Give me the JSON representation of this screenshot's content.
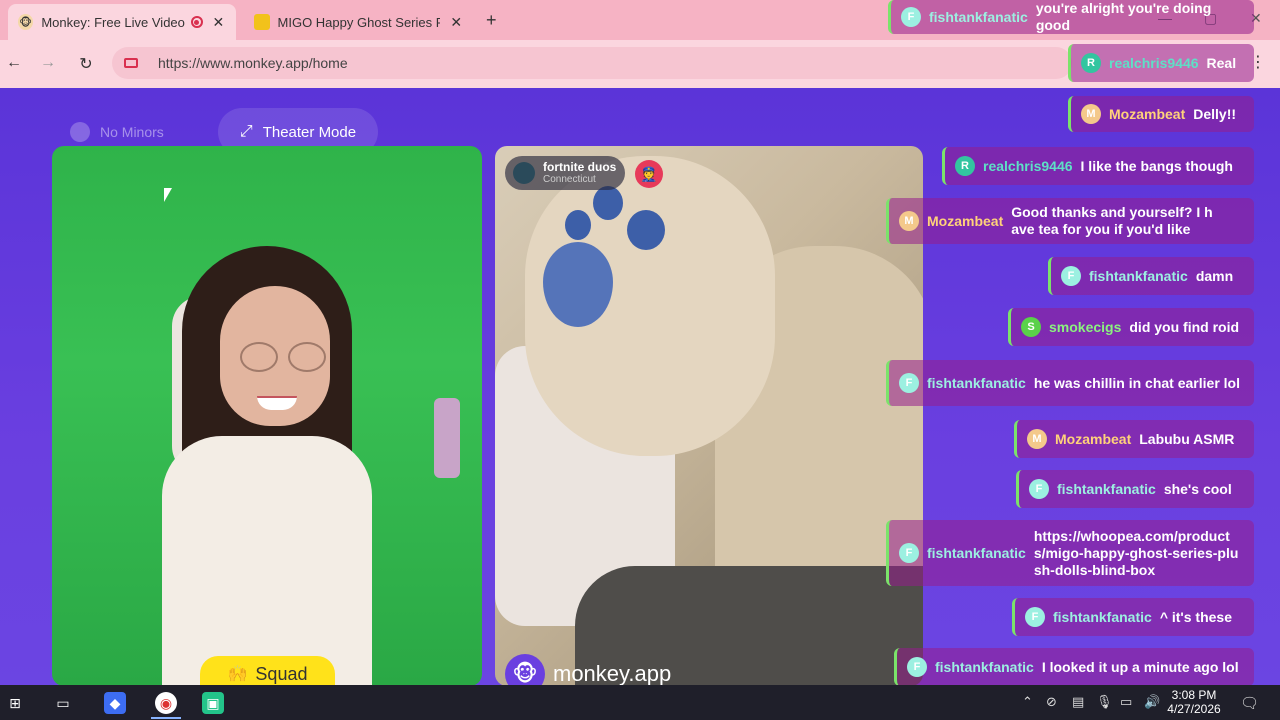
{
  "browser": {
    "tabs": [
      {
        "title": "Monkey: Free Live Video Ch",
        "favicon": "monkey-icon",
        "active": true
      },
      {
        "title": "MIGO Happy Ghost Series Plush",
        "favicon": "migo-icon",
        "active": false
      }
    ],
    "new_tab": "+",
    "url": "https://www.monkey.app/home",
    "back": "←",
    "forward": "→",
    "reload": "↻",
    "menu": "⋮"
  },
  "app": {
    "no_minors": "No Minors",
    "theater_mode": "Theater Mode",
    "squad": "Squad",
    "remote_user": {
      "name": "fortnite duos",
      "location": "Connecticut"
    },
    "brand": "monkey.app"
  },
  "chat": [
    {
      "user": "fishtankfanatic",
      "initial": "F",
      "kind": "fish",
      "message": "you're alright you're doing good"
    },
    {
      "user": "realchris9446",
      "initial": "R",
      "kind": "real",
      "message": "Real"
    },
    {
      "user": "Mozambeat",
      "initial": "M",
      "kind": "moz",
      "message": "Delly!!"
    },
    {
      "user": "realchris9446",
      "initial": "R",
      "kind": "real",
      "message": "I like the bangs though"
    },
    {
      "user": "Mozambeat",
      "initial": "M",
      "kind": "moz",
      "message": "Good thanks and yourself? I have tea for you if you'd like"
    },
    {
      "user": "fishtankfanatic",
      "initial": "F",
      "kind": "fish",
      "message": "damn"
    },
    {
      "user": "smokecigs",
      "initial": "S",
      "kind": "smoke",
      "message": "did you find roid"
    },
    {
      "user": "fishtankfanatic",
      "initial": "F",
      "kind": "fish",
      "message": "he was chillin in chat earlier lol"
    },
    {
      "user": "Mozambeat",
      "initial": "M",
      "kind": "moz",
      "message": "Labubu ASMR"
    },
    {
      "user": "fishtankfanatic",
      "initial": "F",
      "kind": "fish",
      "message": "she's cool"
    },
    {
      "user": "fishtankfanatic",
      "initial": "F",
      "kind": "fish",
      "message": "https://whoopea.com/products/migo-happy-ghost-series-plush-dolls-blind-box"
    },
    {
      "user": "fishtankfanatic",
      "initial": "F",
      "kind": "fish",
      "message": "^ it's these"
    },
    {
      "user": "fishtankfanatic",
      "initial": "F",
      "kind": "fish",
      "message": "I looked it up a minute ago lol"
    }
  ],
  "taskbar": {
    "time": "3:08 PM",
    "date": "4/27/2026"
  },
  "colors": {
    "app_bg": "#6a3fe0",
    "tab_bar": "#f6b3c4",
    "squad_yellow": "#ffe21a",
    "chat_border": "#7be36a"
  }
}
